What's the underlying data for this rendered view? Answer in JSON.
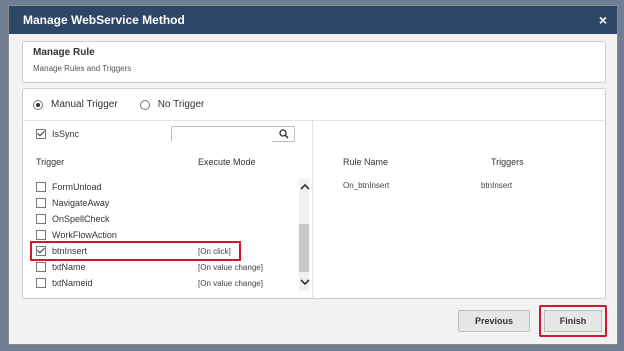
{
  "dialog": {
    "title": "Manage WebService Method",
    "close_glyph": "×"
  },
  "rule": {
    "heading": "Manage Rule",
    "subheading": "Manage Rules and Triggers"
  },
  "trigger_mode": {
    "options": [
      {
        "label": "Manual Trigger",
        "selected": true
      },
      {
        "label": "No Trigger",
        "selected": false
      }
    ]
  },
  "issync": {
    "label": "IsSync",
    "checked": true
  },
  "search": {
    "value": "",
    "placeholder": ""
  },
  "columns": {
    "trigger": "Trigger",
    "execute_mode": "Execute Mode"
  },
  "triggers": [
    {
      "name": "FormUnload",
      "mode": "",
      "checked": false
    },
    {
      "name": "NavigateAway",
      "mode": "",
      "checked": false
    },
    {
      "name": "OnSpellCheck",
      "mode": "",
      "checked": false
    },
    {
      "name": "WorkFlowAction",
      "mode": "",
      "checked": false
    },
    {
      "name": "btnInsert",
      "mode": "[On click]",
      "checked": true
    },
    {
      "name": "txtName",
      "mode": "[On value change]",
      "checked": false
    },
    {
      "name": "txtNameid",
      "mode": "[On value change]",
      "checked": false
    }
  ],
  "rules_table": {
    "headers": {
      "rule_name": "Rule Name",
      "triggers": "Triggers"
    },
    "rows": [
      {
        "rule_name": "On_btnInsert",
        "triggers": "btnInsert"
      }
    ]
  },
  "buttons": {
    "previous": "Previous",
    "finish": "Finish"
  },
  "colors": {
    "titlebar": "#2e4667",
    "highlight": "#d0192a"
  }
}
